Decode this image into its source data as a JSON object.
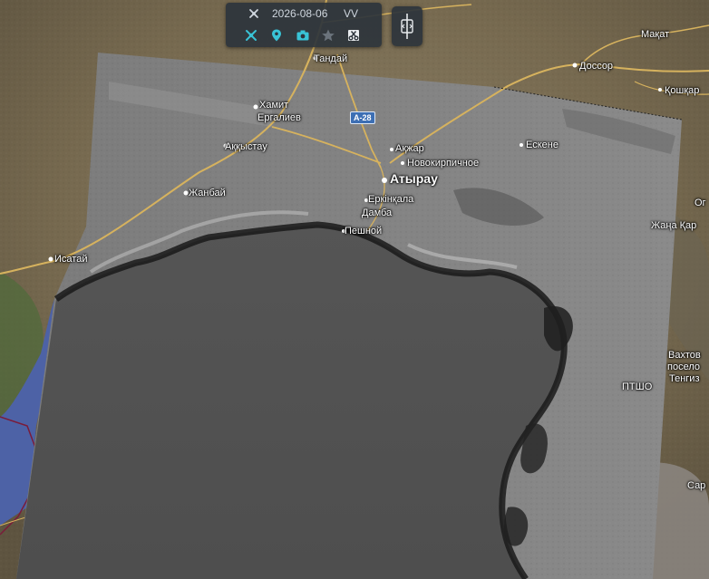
{
  "toolbar": {
    "date": "2026-08-06",
    "polarization": "VV",
    "icons": [
      "satellite-icon",
      "location-pin-icon",
      "camera-icon",
      "star-icon",
      "scissors-icon"
    ],
    "accent_color": "#39c3d6"
  },
  "side_control": {
    "icon": "compare-slider-icon"
  },
  "map": {
    "overlay": "grayscale SAR radar image",
    "places": [
      {
        "name": "Тандай"
      },
      {
        "name": "Хамит"
      },
      {
        "name": "Ергалиев"
      },
      {
        "name": "Аққыстау"
      },
      {
        "name": "Жанбай"
      },
      {
        "name": "Исатай"
      },
      {
        "name": "Ақжар"
      },
      {
        "name": "Новокирпичное"
      },
      {
        "name": "Атырау"
      },
      {
        "name": "Еркінқала"
      },
      {
        "name": "Дамба"
      },
      {
        "name": "Пешной"
      },
      {
        "name": "Ескене"
      },
      {
        "name": "Мақат"
      },
      {
        "name": "Доссор"
      },
      {
        "name": "Қошқар"
      },
      {
        "name": "Жаңа Қар"
      },
      {
        "name": "Вахтов"
      },
      {
        "name": "посело"
      },
      {
        "name": "Тенгиз"
      },
      {
        "name": "ПТШО"
      },
      {
        "name": "Сар"
      },
      {
        "name": "Ог"
      }
    ],
    "road_badge": "A-28"
  }
}
